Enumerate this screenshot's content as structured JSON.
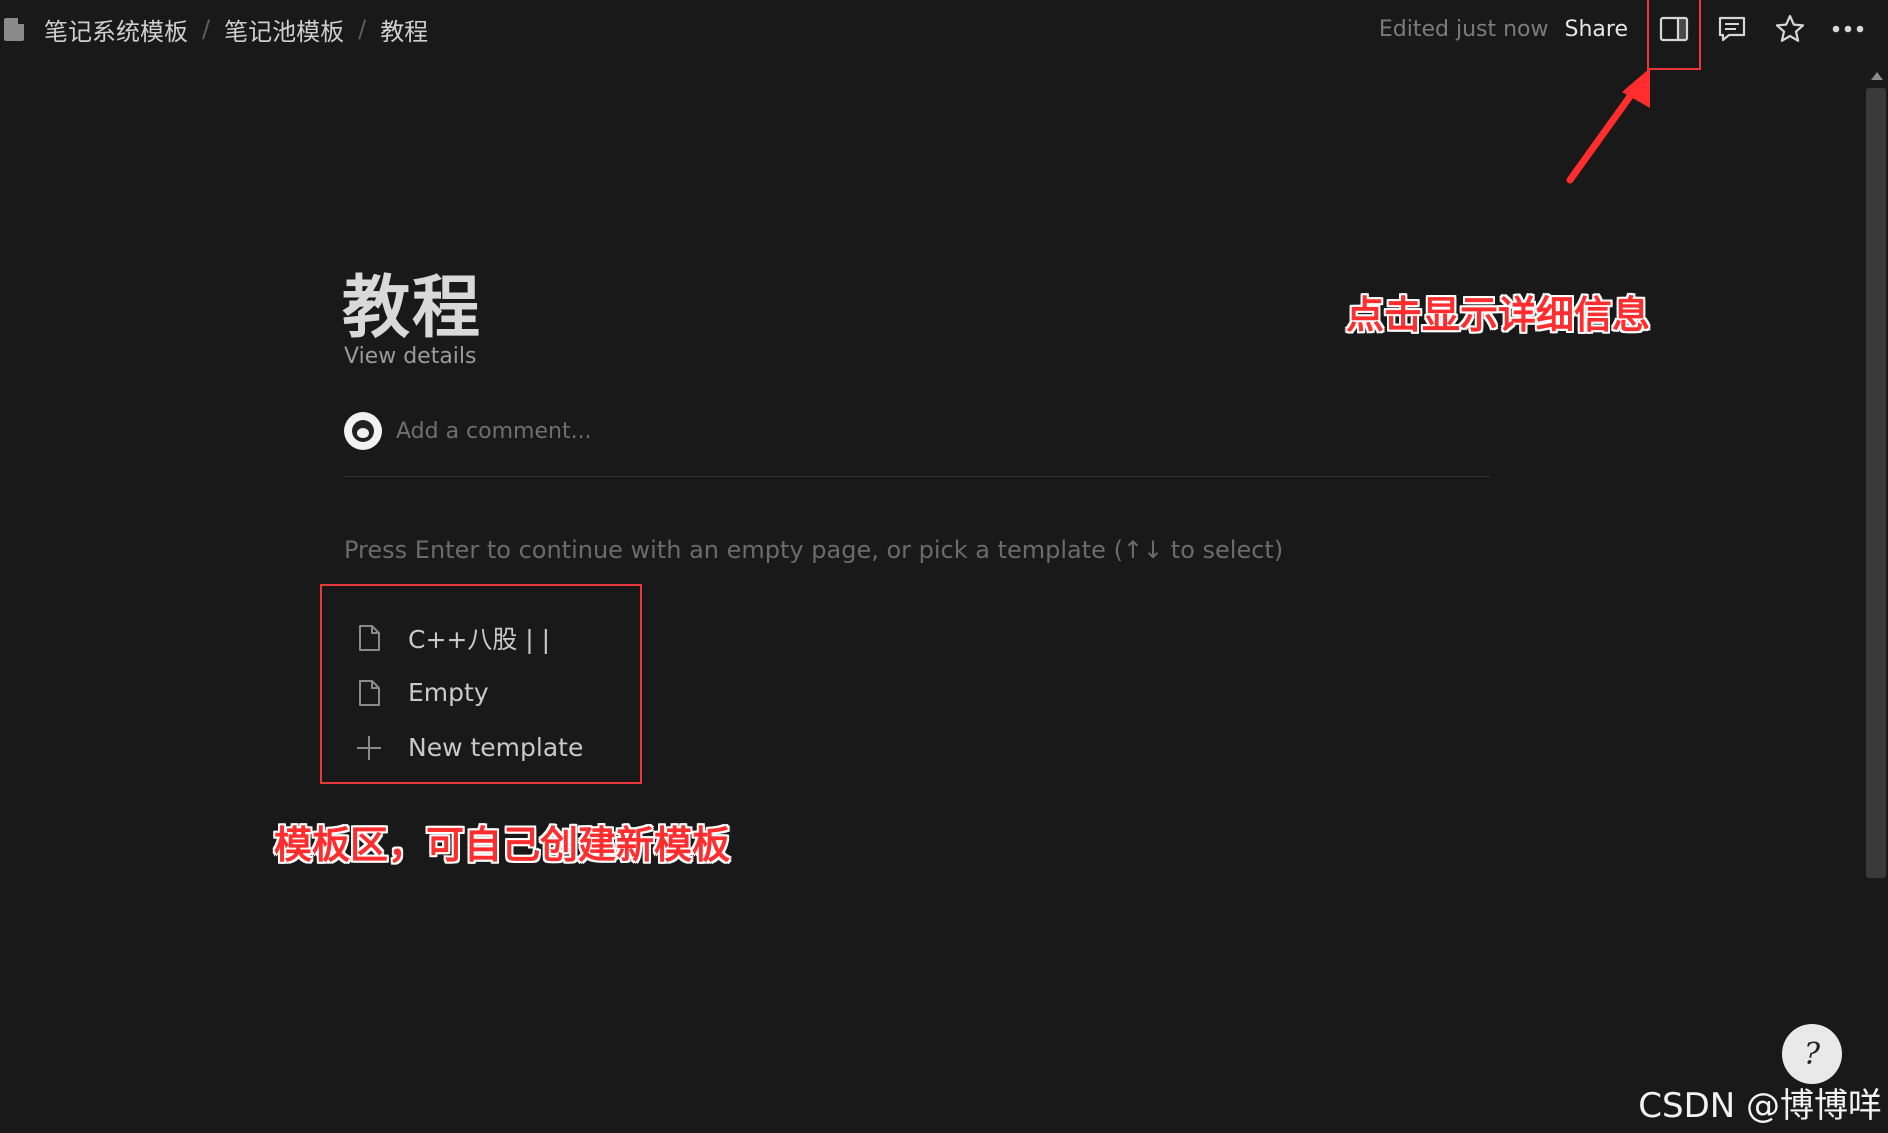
{
  "breadcrumbs": [
    "笔记系统模板",
    "笔记池模板",
    "教程"
  ],
  "breadcrumb_separator": "/",
  "toolbar": {
    "edited": "Edited just now",
    "share": "Share",
    "icons": [
      "sidebar-panel-icon",
      "comment-icon",
      "star-icon",
      "more-icon"
    ]
  },
  "page": {
    "title": "教程",
    "view_details": "View details",
    "comment_placeholder": "Add a comment...",
    "prompt": "Press Enter to continue with an empty page, or pick a template (↑↓ to select)"
  },
  "templates": [
    {
      "label": "C++八股 | |",
      "icon": "page-icon"
    },
    {
      "label": "Empty",
      "icon": "page-icon"
    },
    {
      "label": "New template",
      "icon": "plus-icon"
    }
  ],
  "annotations": {
    "details_note": "点击显示详细信息",
    "template_note": "模板区，可自己创建新模板"
  },
  "watermark": "CSDN @博博咩",
  "colors": {
    "background": "#191919",
    "annotation_red": "#ff2d2d",
    "highlight_box": "#e8383d"
  }
}
